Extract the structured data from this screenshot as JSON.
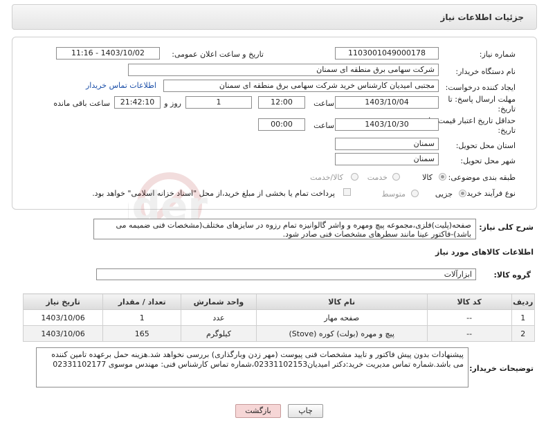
{
  "page": {
    "title": "جزئیات اطلاعات نیاز"
  },
  "form": {
    "need_number": {
      "label": "شماره نیاز:",
      "value": "1103001049000178"
    },
    "announce": {
      "label": "تاریخ و ساعت اعلان عمومی:",
      "value": "1403/10/02 - 11:16"
    },
    "buyer_org": {
      "label": "نام دستگاه خریدار:",
      "value": "شرکت سهامی برق منطقه ای سمنان"
    },
    "requester": {
      "label": "ایجاد کننده درخواست:",
      "value": "مجتبی امیدیان کارشناس خرید شرکت سهامی برق منطقه ای سمنان",
      "contact_link": "اطلاعات تماس خریدار"
    },
    "reply_deadline": {
      "label_line1": "مهلت ارسال پاسخ: تا",
      "label_line2": "تاریخ:",
      "date": "1403/10/04",
      "time_label": "ساعت",
      "time": "12:00",
      "days": "1",
      "days_label": "روز و",
      "remaining": "21:42:10",
      "remaining_label": "ساعت باقی مانده"
    },
    "price_validity": {
      "label_line1": "حداقل تاریخ اعتبار قیمت: تا",
      "label_line2": "تاریخ:",
      "date": "1403/10/30",
      "time_label": "ساعت",
      "time": "00:00"
    },
    "province": {
      "label": "استان محل تحویل:",
      "value": "سمنان"
    },
    "city": {
      "label": "شهر محل تحویل:",
      "value": "سمنان"
    },
    "category": {
      "label": "طبقه بندی موضوعی:",
      "options": [
        "کالا",
        "خدمت",
        "کالا/خدمت"
      ],
      "selected": "کالا"
    },
    "process": {
      "label": "نوع فرآیند خرید :",
      "options": [
        "جزیی",
        "متوسط"
      ],
      "selected": "جزیی",
      "note": "پرداخت تمام یا بخشی از مبلغ خرید،از محل \"اسناد خزانه اسلامی\" خواهد بود."
    }
  },
  "description": {
    "label": "شرح کلی نیاز:",
    "text": "صفحه(پلیت)فلزی،مجموعه پیچ ومهره و واشر گالوانیزه تمام رزوه در سایزهای مختلف(مشخصات فنی ضمیمه می باشد)-فاکتور عینا مانند سطرهای مشخصات فنی صادر شود."
  },
  "goods": {
    "section_title": "اطلاعات کالاهای مورد نیاز",
    "group_label": "گروه کالا:",
    "group_value": "ابزارآلات",
    "columns": [
      "ردیف",
      "کد کالا",
      "نام کالا",
      "واحد شمارش",
      "تعداد / مقدار",
      "تاریخ نیاز"
    ],
    "rows": [
      [
        "1",
        "--",
        "صفحه مهار",
        "عدد",
        "1",
        "1403/10/06"
      ],
      [
        "2",
        "--",
        "پیچ و مهره (بولت) کوره (Stove)",
        "کیلوگرم",
        "165",
        "1403/10/06"
      ]
    ]
  },
  "buyer_notes": {
    "label": "توضیحات خریدار:",
    "text": "پیشنهادات بدون پیش فاکتور و تایید مشخصات فنی پیوست (مهر زدن وبارگذاری) بررسی نخواهد شد.هزینه حمل برعهده تامین کننده می باشد.شماره تماس مدیریت خرید:دکتر امیدیان02331102153،شماره تماس کارشناس فنی: مهندس موسوی 02331102177"
  },
  "buttons": {
    "print": "چاپ",
    "back": "بازگشت"
  },
  "colors": {
    "link": "#1a4ea8",
    "back_button_bg": "#f6d6d6"
  }
}
